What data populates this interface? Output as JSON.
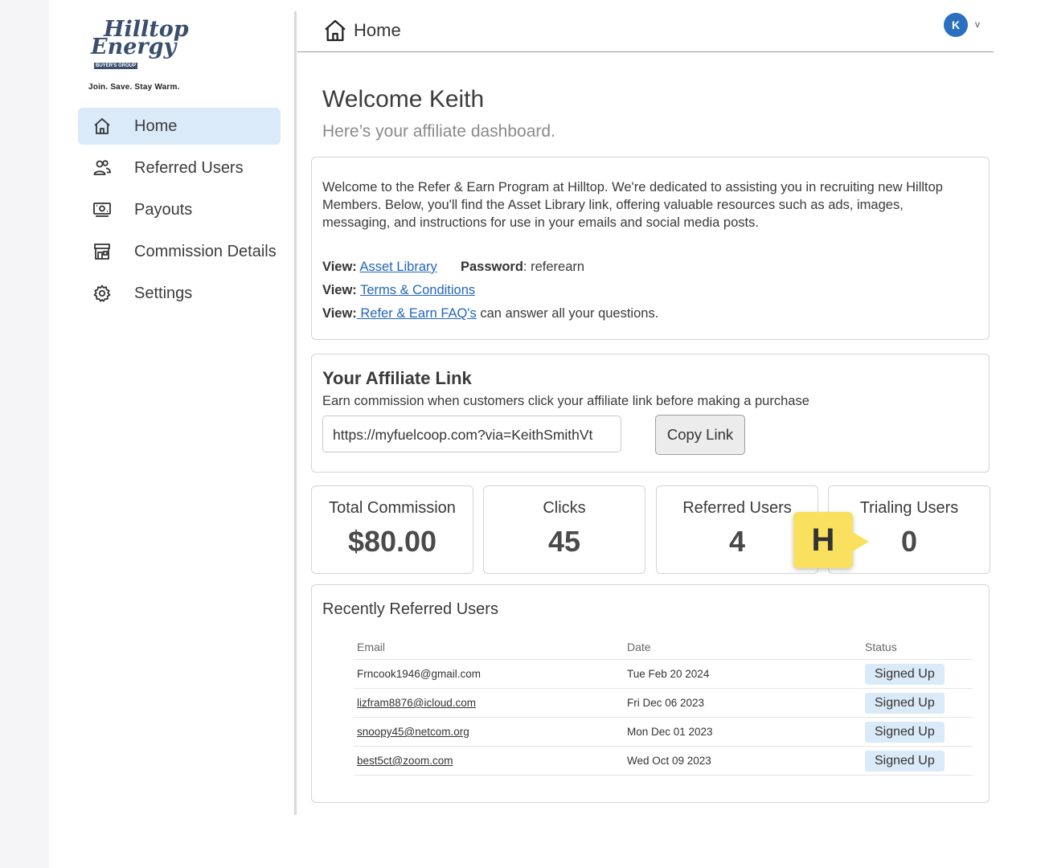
{
  "logo": {
    "line1": "Hilltop",
    "line2": "Energy",
    "group": "BUYER'S GROUP"
  },
  "tagline": "Join. Save. Stay Warm.",
  "sidebar": {
    "items": [
      {
        "label": "Home",
        "icon": "home-icon",
        "active": true
      },
      {
        "label": "Referred Users",
        "icon": "users-icon"
      },
      {
        "label": "Payouts",
        "icon": "money-icon"
      },
      {
        "label": "Commission Details",
        "icon": "store-icon"
      },
      {
        "label": "Settings",
        "icon": "gear-icon"
      }
    ]
  },
  "header": {
    "title": "Home",
    "avatar_initial": "K",
    "avatar_caret": "v"
  },
  "main": {
    "welcome": "Welcome Keith",
    "subtitle": "Here’s your affiliate dashboard.",
    "intro": "Welcome to the Refer & Earn Program at Hilltop. We're dedicated to assisting you in recruiting new Hilltop Members. Below, you'll find the Asset Library link, offering valuable resources such as ads, images, messaging, and instructions for use in your emails and social media posts.",
    "view_label": "View:",
    "asset_library": "Asset Library",
    "password_label": "Password",
    "password_value": ": referearn",
    "terms": "Terms & Conditions",
    "faq": " Refer & Earn FAQ's",
    "faq_suffix": " can answer all your questions."
  },
  "affiliate": {
    "title": "Your Affiliate Link",
    "description": "Earn commission when customers click your affiliate link before making a purchase",
    "link": "https://myfuelcoop.com?via=KeithSmithVt",
    "copy_label": "Copy Link"
  },
  "stats": [
    {
      "label": "Total Commission",
      "value": "$80.00"
    },
    {
      "label": "Clicks",
      "value": "45"
    },
    {
      "label": "Referred Users",
      "value": "4"
    },
    {
      "label": "Trialing Users",
      "value": "0"
    }
  ],
  "overlay_badge": "H",
  "recent": {
    "title": "Recently Referred Users",
    "columns": [
      "Email",
      "Date",
      "Status"
    ],
    "rows": [
      {
        "email": "Frncook1946@gmail.com",
        "date": "Tue Feb 20 2024",
        "status": "Signed Up",
        "linked": false
      },
      {
        "email": "lizfram8876@icloud.com",
        "date": "Fri Dec 06 2023",
        "status": "Signed Up",
        "linked": true
      },
      {
        "email": "snoopy45@netcom.org",
        "date": "Mon Dec 01 2023",
        "status": "Signed Up",
        "linked": true
      },
      {
        "email": "best5ct@zoom.com",
        "date": "Wed Oct 09 2023",
        "status": "Signed Up",
        "linked": true
      }
    ]
  },
  "colors": {
    "accent": "#2c6fbf",
    "active_nav": "#dbeaf8",
    "badge": "#f9e15f",
    "link": "#2366b8"
  }
}
